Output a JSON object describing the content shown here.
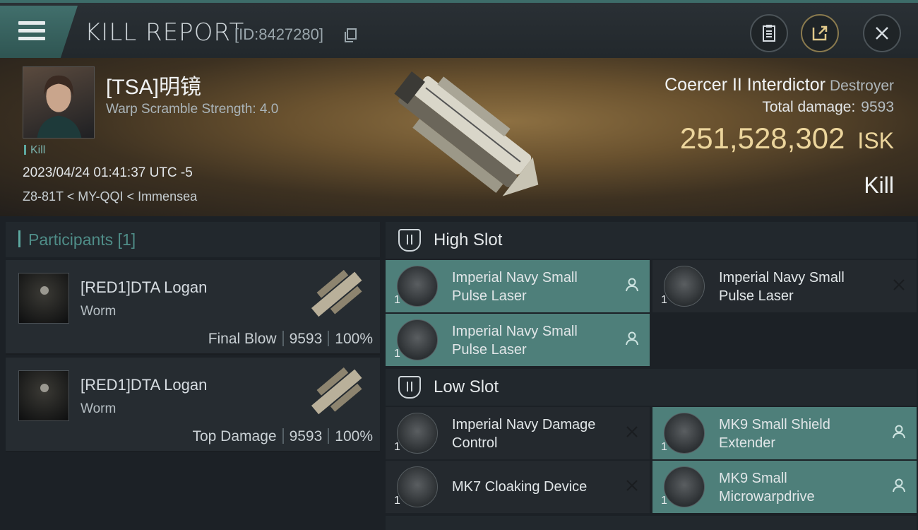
{
  "header": {
    "title": "KILL REPORT",
    "report_id": "[ID:8427280]"
  },
  "victim": {
    "pilot_name": "[TSA]明镜",
    "warp_scramble": "Warp Scramble Strength: 4.0",
    "kill_tag": "Kill",
    "datetime": "2023/04/24 01:41:37 UTC -5",
    "location": "Z8-81T < MY-QQI < Immensea",
    "ship_name": "Coercer II Interdictor",
    "ship_class": "Destroyer",
    "total_damage_label": "Total damage:",
    "total_damage_value": "9593",
    "isk_value": "251,528,302",
    "isk_unit": "ISK",
    "result": "Kill"
  },
  "participants": {
    "header": "Participants [1]",
    "items": [
      {
        "name": "[RED1]DTA Logan",
        "ship": "Worm",
        "role": "Final Blow",
        "damage": "9593",
        "percent": "100%"
      },
      {
        "name": "[RED1]DTA Logan",
        "ship": "Worm",
        "role": "Top Damage",
        "damage": "9593",
        "percent": "100%"
      }
    ]
  },
  "slots": {
    "high": {
      "label": "High Slot",
      "modules": [
        {
          "name": "Imperial Navy Small Pulse Laser",
          "qty": "1",
          "status": "dropped"
        },
        {
          "name": "Imperial Navy Small Pulse Laser",
          "qty": "1",
          "status": "destroyed"
        },
        {
          "name": "Imperial Navy Small Pulse Laser",
          "qty": "1",
          "status": "dropped"
        }
      ]
    },
    "low": {
      "label": "Low Slot",
      "modules": [
        {
          "name": "Imperial Navy Damage Control",
          "qty": "1",
          "status": "destroyed"
        },
        {
          "name": "MK9 Small Shield Extender",
          "qty": "1",
          "status": "dropped"
        },
        {
          "name": "MK7 Cloaking Device",
          "qty": "1",
          "status": "destroyed"
        },
        {
          "name": "MK9 Small Microwarpdrive",
          "qty": "1",
          "status": "dropped"
        }
      ]
    }
  },
  "colors": {
    "accent": "#5da8a0",
    "highlight": "#4e7f7a",
    "isk": "#ecd59c"
  }
}
